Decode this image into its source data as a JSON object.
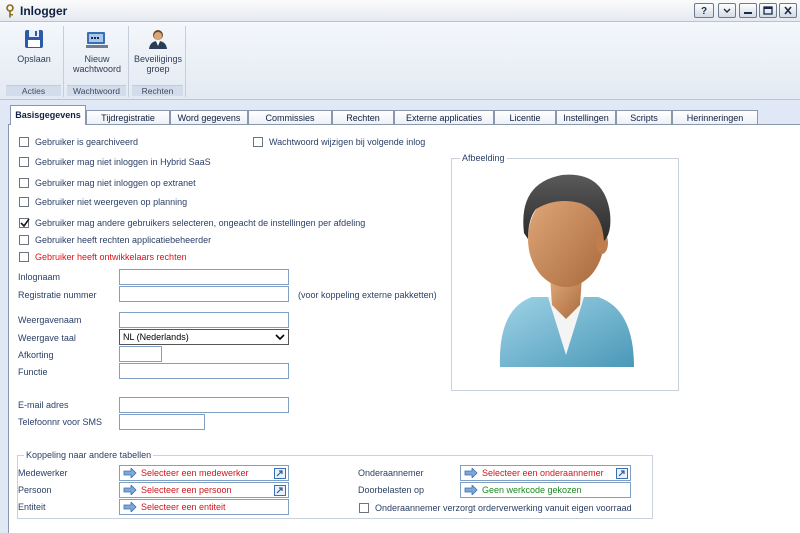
{
  "window": {
    "title": "Inlogger"
  },
  "ribbon": {
    "groups": [
      {
        "caption": "Acties",
        "buttons": [
          {
            "label": "Opslaan",
            "icon": "save-icon"
          }
        ]
      },
      {
        "caption": "Wachtwoord",
        "buttons": [
          {
            "label": "Nieuw wachtwoord",
            "icon": "new-password-icon"
          }
        ]
      },
      {
        "caption": "Rechten",
        "buttons": [
          {
            "label": "Beveiligings groep",
            "icon": "security-group-icon"
          }
        ]
      }
    ]
  },
  "tabs": [
    {
      "label": "Basisgegevens",
      "active": true
    },
    {
      "label": "Tijdregistratie"
    },
    {
      "label": "Word gegevens"
    },
    {
      "label": "Commissies"
    },
    {
      "label": "Rechten"
    },
    {
      "label": "Externe applicaties"
    },
    {
      "label": "Licentie"
    },
    {
      "label": "Instellingen"
    },
    {
      "label": "Scripts"
    },
    {
      "label": "Herinneringen"
    }
  ],
  "checkboxes": {
    "archived": {
      "label": "Gebruiker is gearchiveerd",
      "checked": false
    },
    "change_pw": {
      "label": "Wachtwoord wijzigen bij volgende inlog",
      "checked": false
    },
    "no_saas": {
      "label": "Gebruiker mag niet inloggen in Hybrid SaaS",
      "checked": false
    },
    "no_extranet": {
      "label": "Gebruiker mag niet inloggen op extranet",
      "checked": false
    },
    "no_planning": {
      "label": "Gebruiker niet weergeven op planning",
      "checked": false
    },
    "select_users": {
      "label": "Gebruiker mag andere gebruikers selecteren, ongeacht de instellingen per afdeling",
      "checked": true
    },
    "app_admin": {
      "label": "Gebruiker heeft rechten applicatiebeheerder",
      "checked": false
    },
    "developer": {
      "label": "Gebruiker heeft ontwikkelaars rechten",
      "checked": false
    }
  },
  "form": {
    "inlognaam": {
      "label": "Inlognaam",
      "value": ""
    },
    "registratie": {
      "label": "Registratie nummer",
      "value": "",
      "hint": "(voor koppeling externe pakketten)"
    },
    "weergavenaam": {
      "label": "Weergavenaam",
      "value": ""
    },
    "taal": {
      "label": "Weergave taal",
      "value": "NL (Nederlands)"
    },
    "afkorting": {
      "label": "Afkorting",
      "value": ""
    },
    "functie": {
      "label": "Functie",
      "value": ""
    },
    "email": {
      "label": "E-mail adres",
      "value": ""
    },
    "sms": {
      "label": "Telefoonnr voor SMS",
      "value": ""
    }
  },
  "picture": {
    "caption": "Afbeelding",
    "icon": "user-avatar-icon"
  },
  "links": {
    "caption": "Koppeling naar andere tabellen",
    "medewerker": {
      "label": "Medewerker",
      "value": "Selecteer een medewerker"
    },
    "persoon": {
      "label": "Persoon",
      "value": "Selecteer een persoon"
    },
    "entiteit": {
      "label": "Entiteit",
      "value": "Selecteer een entiteit"
    },
    "onderaannemer": {
      "label": "Onderaannemer",
      "value": "Selecteer een onderaannemer"
    },
    "doorbelasten": {
      "label": "Doorbelasten op",
      "value": "Geen werkcode gekozen"
    },
    "eigen_voorraad": {
      "label": "Onderaannemer verzorgt orderverwerking vanuit eigen voorraad",
      "checked": false
    }
  },
  "colors": {
    "accent": "#3a6fb0",
    "warning_text": "#e0101a",
    "ok_text": "#1a8a20",
    "window_bg": "#dfe8f4"
  }
}
